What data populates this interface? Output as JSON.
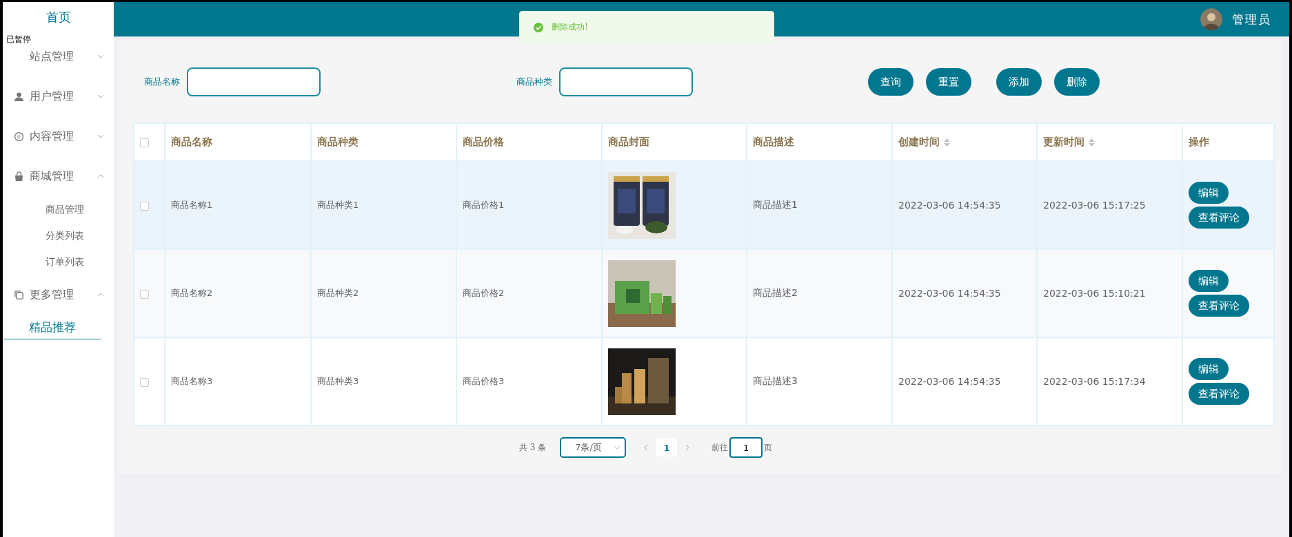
{
  "sidebar": {
    "home": "首页",
    "recorder_badge": "已暂停",
    "menus": [
      {
        "label": "站点管理",
        "expanded": false
      },
      {
        "label": "用户管理",
        "expanded": false
      },
      {
        "label": "内容管理",
        "expanded": false
      },
      {
        "label": "商城管理",
        "expanded": true,
        "children": [
          {
            "label": "商品管理",
            "selected": false
          },
          {
            "label": "分类列表",
            "selected": false
          },
          {
            "label": "订单列表",
            "selected": false
          }
        ]
      },
      {
        "label": "更多管理",
        "expanded": true,
        "children": [
          {
            "label": "精品推荐",
            "selected": true
          }
        ]
      }
    ]
  },
  "header": {
    "user": "管理员"
  },
  "toast": {
    "message": "删除成功!"
  },
  "search": {
    "fields": [
      {
        "label": "商品名称"
      },
      {
        "label": "商品种类"
      }
    ],
    "buttons": [
      "查询",
      "重置",
      "添加",
      "删除"
    ]
  },
  "table": {
    "columns": [
      {
        "label": "商品名称",
        "sortable": false
      },
      {
        "label": "商品种类",
        "sortable": false
      },
      {
        "label": "商品价格",
        "sortable": false
      },
      {
        "label": "商品封面",
        "sortable": false
      },
      {
        "label": "商品描述",
        "sortable": false
      },
      {
        "label": "创建时间",
        "sortable": true
      },
      {
        "label": "更新时间",
        "sortable": true
      },
      {
        "label": "操作",
        "sortable": false
      }
    ],
    "all_checked": false,
    "rows": [
      {
        "checked": false,
        "highlighted": true,
        "cells": [
          "商品名称1",
          "商品种类1",
          "商品价格1",
          {
            "kind": "picture"
          },
          "商品描述1",
          "2022-03-06 14:54:35",
          "2022-03-06 15:17:25"
        ],
        "actions": [
          "编辑",
          "查看评论"
        ]
      },
      {
        "checked": false,
        "highlighted": false,
        "cells": [
          "商品名称2",
          "商品种类2",
          "商品价格2",
          {
            "kind": "picture"
          },
          "商品描述2",
          "2022-03-06 14:54:35",
          "2022-03-06 15:10:21"
        ],
        "actions": [
          "编辑",
          "查看评论"
        ]
      },
      {
        "checked": false,
        "highlighted": false,
        "cells": [
          "商品名称3",
          "商品种类3",
          "商品价格3",
          {
            "kind": "picture"
          },
          "商品描述3",
          "2022-03-06 14:54:35",
          "2022-03-06 15:17:34"
        ],
        "actions": [
          "编辑",
          "查看评论"
        ]
      }
    ]
  },
  "pagination": {
    "total": "共 3 条",
    "page_size": "7条/页",
    "pages": [
      {
        "label": "1",
        "selected": true
      }
    ],
    "goto_label": "前往",
    "goto_value": "1",
    "goto_suffix": "页"
  }
}
